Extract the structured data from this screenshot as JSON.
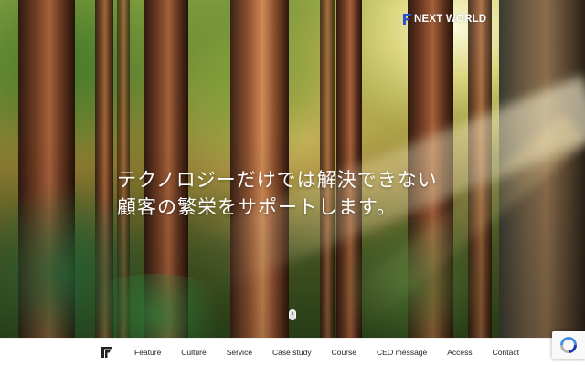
{
  "brand": {
    "logo_text": "NEXT WORLD",
    "logo_accent_color": "#2b4fd6"
  },
  "hero": {
    "headline_line1": "テクノロジーだけでは解決できない",
    "headline_line2": "顧客の繁栄をサポートします。"
  },
  "nav": {
    "logo_icon": "ff-logo-icon",
    "items": [
      {
        "label": "Feature"
      },
      {
        "label": "Culture"
      },
      {
        "label": "Service"
      },
      {
        "label": "Case study"
      },
      {
        "label": "Course"
      },
      {
        "label": "CEO message"
      },
      {
        "label": "Access"
      },
      {
        "label": "Contact"
      }
    ]
  },
  "widgets": {
    "scroll_icon": "mouse-scroll-icon",
    "recaptcha_icon": "recaptcha-icon"
  }
}
